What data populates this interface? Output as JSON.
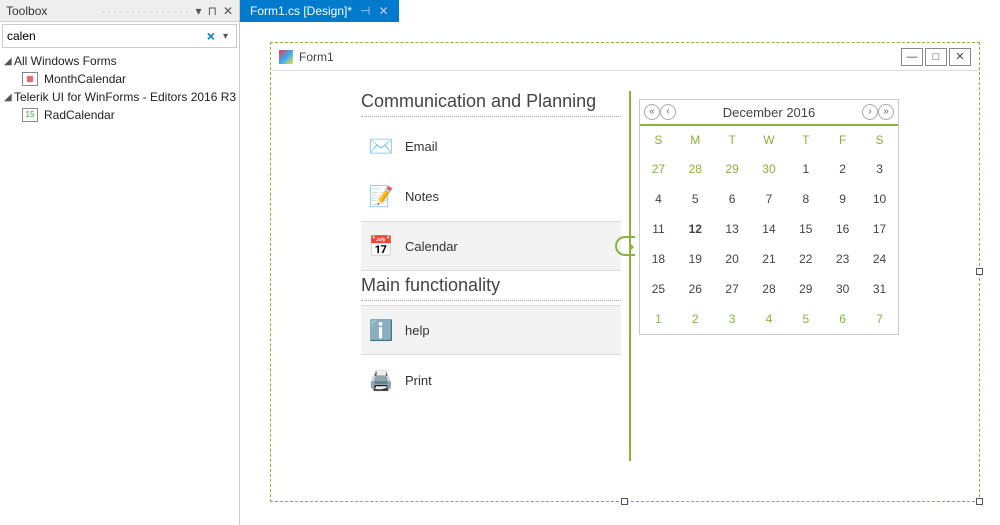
{
  "toolbox": {
    "title": "Toolbox",
    "search_value": "calen",
    "groups": [
      {
        "label": "All Windows Forms",
        "items": [
          {
            "label": "MonthCalendar"
          }
        ]
      },
      {
        "label": "Telerik UI for WinForms - Editors 2016 R3",
        "items": [
          {
            "label": "RadCalendar"
          }
        ]
      }
    ]
  },
  "tab": {
    "label": "Form1.cs [Design]*"
  },
  "form": {
    "title": "Form1",
    "sections": [
      {
        "header": "Communication and Planning",
        "items": [
          {
            "label": "Email",
            "icon": "✉️",
            "selected": false
          },
          {
            "label": "Notes",
            "icon": "📝",
            "selected": false
          },
          {
            "label": "Calendar",
            "icon": "📅",
            "selected": true
          }
        ]
      },
      {
        "header": "Main functionality",
        "items": [
          {
            "label": "help",
            "icon": "ℹ️",
            "selected": true
          },
          {
            "label": "Print",
            "icon": "🖨️",
            "selected": false
          }
        ]
      }
    ]
  },
  "calendar": {
    "title": "December 2016",
    "dow": [
      "S",
      "M",
      "T",
      "W",
      "T",
      "F",
      "S"
    ],
    "weeks": [
      [
        {
          "d": 27,
          "o": true
        },
        {
          "d": 28,
          "o": true
        },
        {
          "d": 29,
          "o": true
        },
        {
          "d": 30,
          "o": true
        },
        {
          "d": 1
        },
        {
          "d": 2
        },
        {
          "d": 3
        }
      ],
      [
        {
          "d": 4
        },
        {
          "d": 5
        },
        {
          "d": 6
        },
        {
          "d": 7
        },
        {
          "d": 8
        },
        {
          "d": 9
        },
        {
          "d": 10
        }
      ],
      [
        {
          "d": 11
        },
        {
          "d": 12,
          "t": true
        },
        {
          "d": 13
        },
        {
          "d": 14
        },
        {
          "d": 15
        },
        {
          "d": 16
        },
        {
          "d": 17
        }
      ],
      [
        {
          "d": 18
        },
        {
          "d": 19
        },
        {
          "d": 20
        },
        {
          "d": 21
        },
        {
          "d": 22
        },
        {
          "d": 23
        },
        {
          "d": 24
        }
      ],
      [
        {
          "d": 25
        },
        {
          "d": 26
        },
        {
          "d": 27
        },
        {
          "d": 28
        },
        {
          "d": 29
        },
        {
          "d": 30
        },
        {
          "d": 31
        }
      ],
      [
        {
          "d": 1,
          "o": true
        },
        {
          "d": 2,
          "o": true
        },
        {
          "d": 3,
          "o": true
        },
        {
          "d": 4,
          "o": true
        },
        {
          "d": 5,
          "o": true
        },
        {
          "d": 6,
          "o": true
        },
        {
          "d": 7,
          "o": true
        }
      ]
    ]
  }
}
